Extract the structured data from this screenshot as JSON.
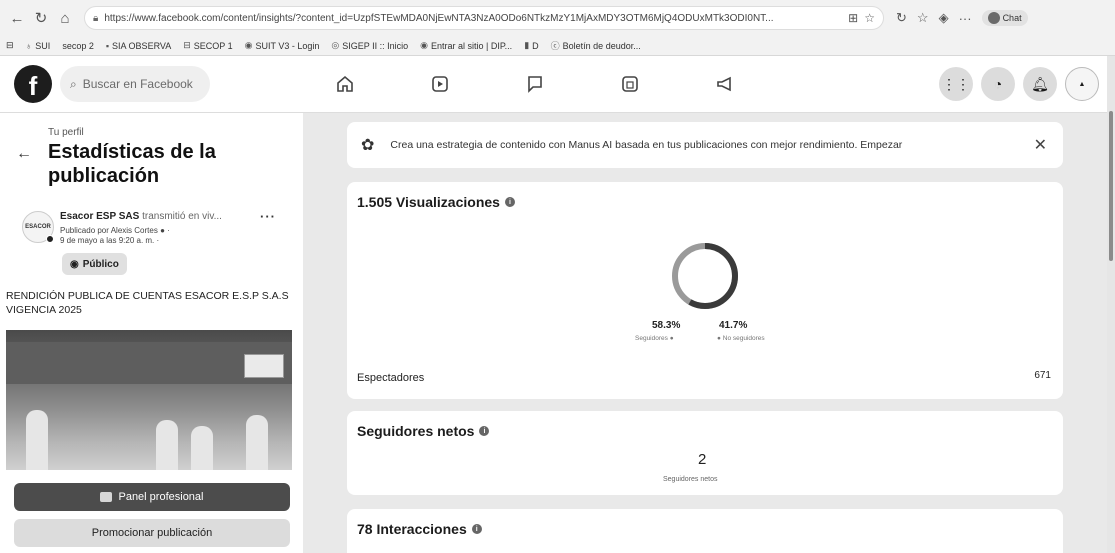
{
  "browser": {
    "url": "https://www.facebook.com/content/insights/?content_id=UzpfSTEwMDA0NjEwNTA3NzA0ODo6NTkzMzY1MjAxMDY3OTM6MjQ4ODUxMTk3ODI0NT...",
    "profile_label": "Chat"
  },
  "bookmarks": [
    {
      "icon": "grid",
      "label": "SUI"
    },
    {
      "icon": "none",
      "label": "secop 2"
    },
    {
      "icon": "grid",
      "label": "SIA OBSERVA"
    },
    {
      "icon": "doc",
      "label": "SECOP 1"
    },
    {
      "icon": "grid",
      "label": "SUIT V3 - Login"
    },
    {
      "icon": "grid",
      "label": "SIGEP II :: Inicio"
    },
    {
      "icon": "grid",
      "label": "Entrar al sitio | DIP..."
    },
    {
      "icon": "grid",
      "label": "D"
    },
    {
      "icon": "grid",
      "label": "Boletín de deudor..."
    }
  ],
  "fb_header": {
    "logo": "f",
    "search_placeholder": "Buscar en Facebook"
  },
  "left_panel": {
    "back_label": "Tu perfil",
    "title": "Estadísticas de la publicación",
    "post": {
      "author": "Esacor ESP SAS",
      "action": "transmitió en viv...",
      "published_by": "Publicado por Alexis Cortes",
      "date": "9 de mayo a las 9:20 a. m.",
      "audience": "Público",
      "text": "RENDICIÓN PUBLICA DE CUENTAS ESACOR E.S.P S.A.S VIGENCIA 2025",
      "avatar_text": "ESACOR"
    },
    "btn_panel": "Panel profesional",
    "btn_promote": "Promocionar publicación"
  },
  "banner": {
    "text": "Crea una estrategia de contenido con Manus AI basada en tus publicaciones con mejor rendimiento. Empezar"
  },
  "views_card": {
    "title": "1.505 Visualizaciones",
    "followers_pct": "58.3%",
    "followers_label": "Seguidores",
    "nonfollowers_pct": "41.7%",
    "nonfollowers_label": "No seguidores",
    "followers_share": 0.583,
    "viewers_label": "Espectadores",
    "viewers_value": "671"
  },
  "net_followers_card": {
    "title": "Seguidores netos",
    "value": "2",
    "caption": "Seguidores netos"
  },
  "interactions_card": {
    "title": "78 Interacciones"
  },
  "colors": {
    "donut_dark": "#3a3a3a",
    "donut_light": "#9a9a9a"
  }
}
